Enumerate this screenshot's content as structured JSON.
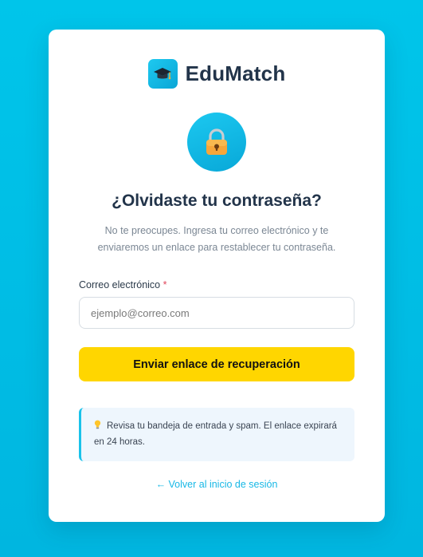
{
  "brand": {
    "name": "EduMatch",
    "icon": "graduation-cap-icon",
    "accent_color": "#00bfe8"
  },
  "header": {
    "icon": "padlock-icon",
    "title": "¿Olvidaste tu contraseña?",
    "subtitle": "No te preocupes. Ingresa tu correo electrónico y te enviaremos un enlace para restablecer tu contraseña."
  },
  "form": {
    "email_label": "Correo electrónico",
    "required_mark": "*",
    "email_placeholder": "ejemplo@correo.com",
    "email_value": "",
    "submit_label": "Enviar enlace de recuperación",
    "submit_color": "#ffd600"
  },
  "info": {
    "icon": "lightbulb-icon",
    "text": "Revisa tu bandeja de entrada y spam. El enlace expirará en 24 horas."
  },
  "footer": {
    "back_link": "← Volver al inicio de sesión"
  }
}
